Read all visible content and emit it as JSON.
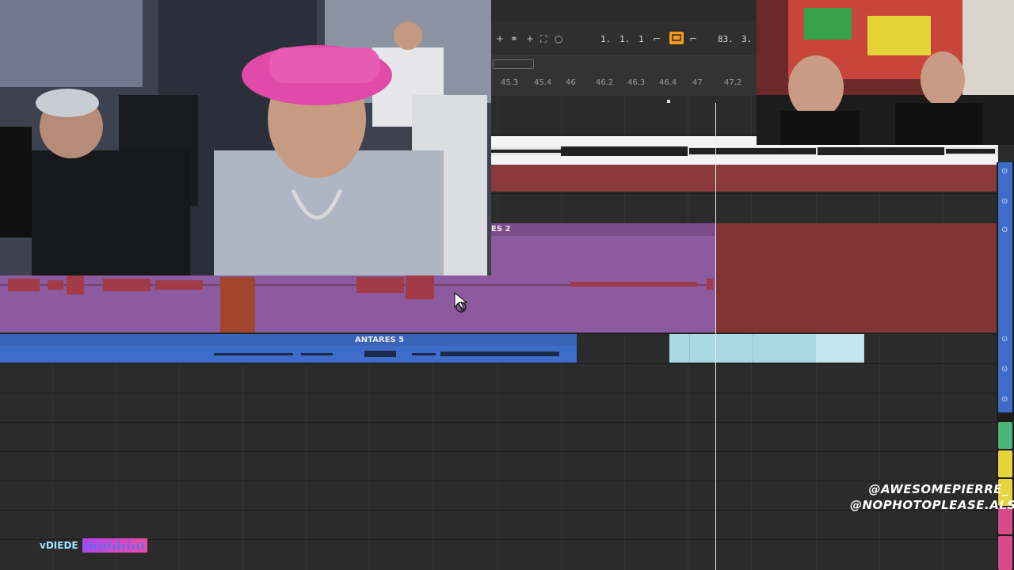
{
  "transport": {
    "position_bar": "1.",
    "position_beat": "1.",
    "position_sixteenth": "1",
    "tempo_fragment": "83.",
    "signature_fragment": "3."
  },
  "ruler": {
    "ticks": [
      "45.3",
      "45.4",
      "46",
      "46.2",
      "46.3",
      "46.4",
      "47",
      "47.2"
    ]
  },
  "tracks": {
    "purple_clip_label": "ES 2",
    "blue_clip_label": "ANTARES 5"
  },
  "overlay": {
    "credit_line1": "@AWESOMEPIERRE_",
    "credit_line2": "@NOPHOTOPLEASE.ALS",
    "brand_text": "vDIEDE"
  },
  "colors": {
    "accent_orange": "#f39c1f",
    "clip_purple": "#8c5a9e",
    "clip_red": "#823434",
    "clip_blue": "#3d6dc9",
    "clip_lightblue": "#a9d9e3"
  }
}
